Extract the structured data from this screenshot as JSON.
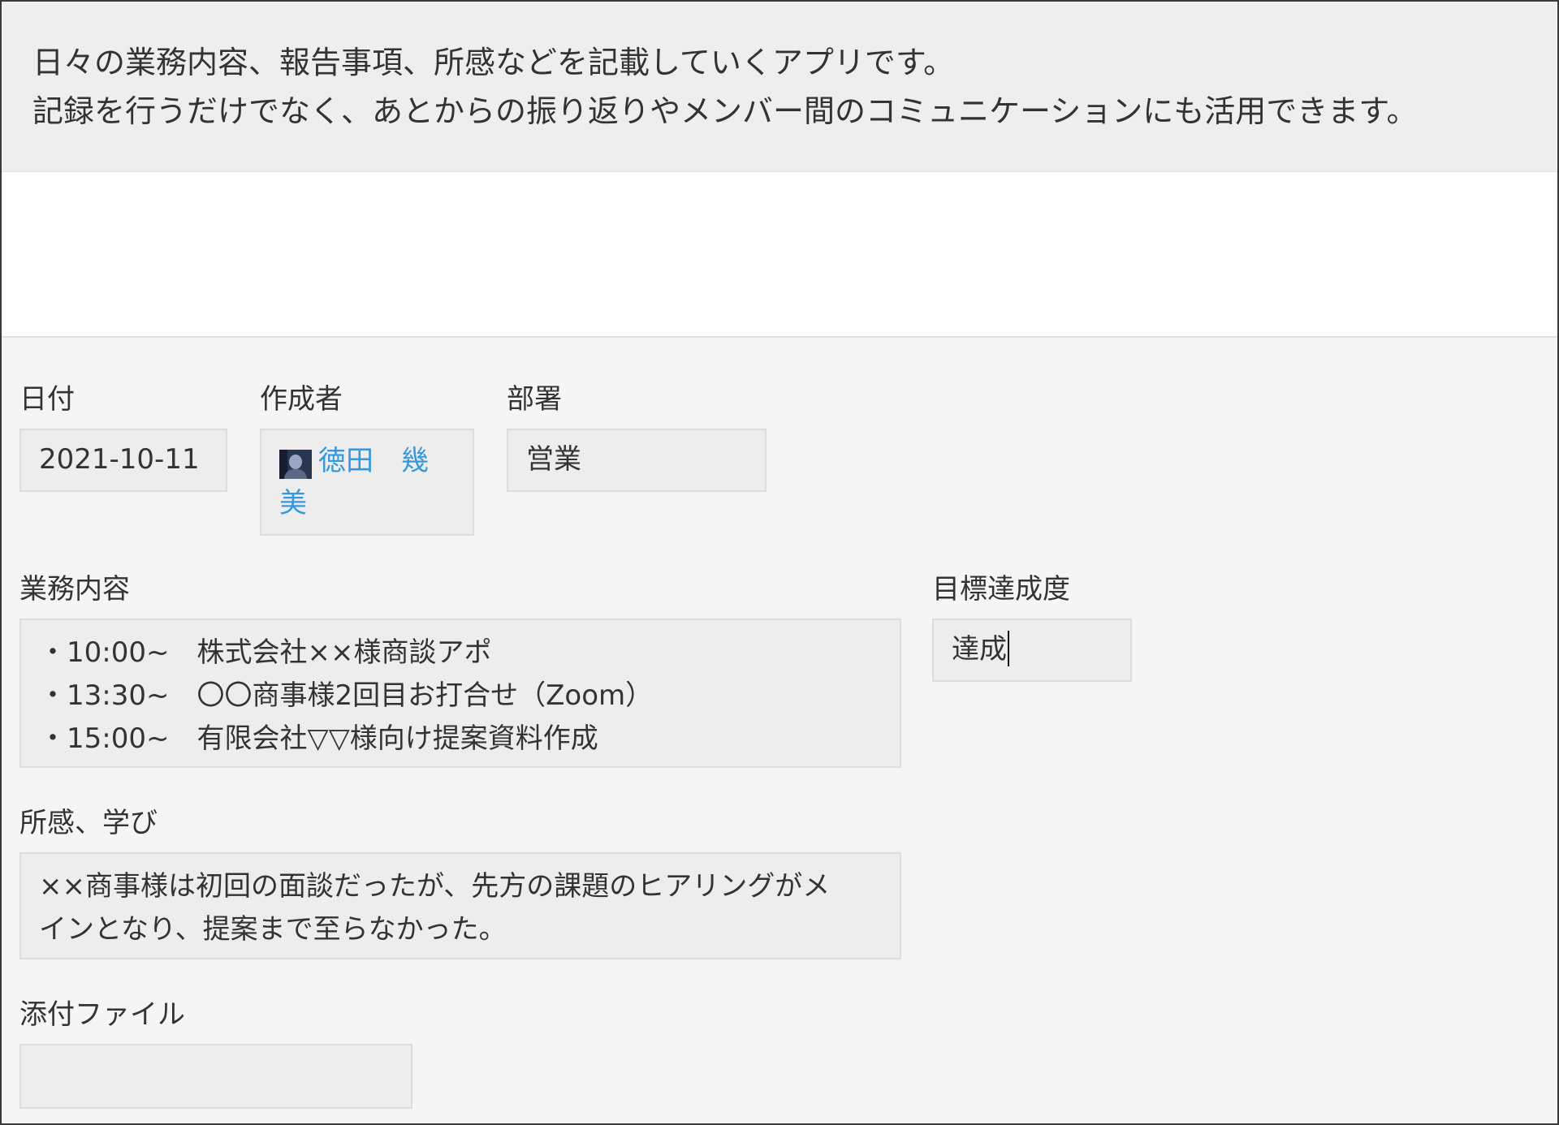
{
  "description": {
    "line1": "日々の業務内容、報告事項、所感などを記載していくアプリです。",
    "line2": "記録を行うだけでなく、あとからの振り返りやメンバー間のコミュニケーションにも活用できます。"
  },
  "fields": {
    "date": {
      "label": "日付",
      "value": "2021-10-11"
    },
    "author": {
      "label": "作成者",
      "name": "徳田　幾美",
      "icon": "user-avatar-icon"
    },
    "department": {
      "label": "部署",
      "value": "営業"
    },
    "work": {
      "label": "業務内容",
      "lines": [
        "・10:00~　株式会社××様商談アポ",
        "・13:30~　〇〇商事様2回目お打合せ（Zoom）",
        "・15:00~　有限会社▽▽様向け提案資料作成"
      ]
    },
    "goal": {
      "label": "目標達成度",
      "value": "達成"
    },
    "impressions": {
      "label": "所感、学び",
      "lines": [
        "××商事様は初回の面談だったが、先方の課題のヒアリングがメ",
        "インとなり、提案まで至らなかった。"
      ]
    },
    "attachment": {
      "label": "添付ファイル",
      "value": ""
    }
  },
  "colors": {
    "description_bg": "#eeeeee",
    "form_bg": "#f5f5f5",
    "field_bg": "#ededed",
    "link": "#3498db"
  }
}
